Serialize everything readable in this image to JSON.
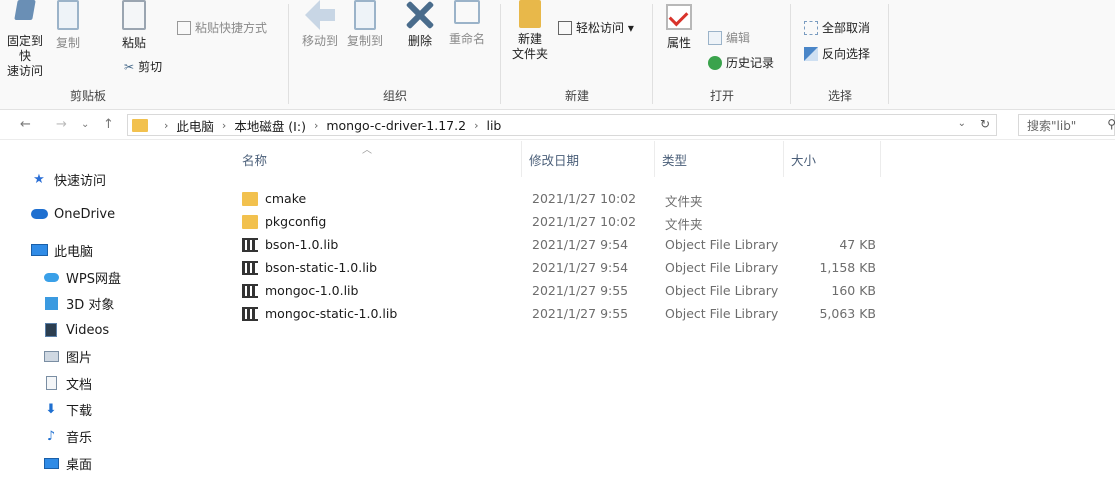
{
  "ribbon": {
    "clipboard": {
      "title": "剪贴板",
      "pin_label": "固定到快\n速访问",
      "copy_label": "复制",
      "paste_label": "粘贴",
      "paste_shortcut_label": "粘贴快捷方式",
      "cut_label": "剪切"
    },
    "organize": {
      "title": "组织",
      "move_label": "移动到",
      "copyto_label": "复制到",
      "delete_label": "删除",
      "rename_label": "重命名"
    },
    "new": {
      "title": "新建",
      "new_folder_label": "新建\n文件夹",
      "easy_access_label": "轻松访问 ▾"
    },
    "open": {
      "title": "打开",
      "properties_label": "属性",
      "edit_label": "编辑",
      "history_label": "历史记录"
    },
    "select": {
      "title": "选择",
      "select_none_label": "全部取消",
      "invert_label": "反向选择"
    }
  },
  "address": {
    "crumbs": [
      "此电脑",
      "本地磁盘 (I:)",
      "mongo-c-driver-1.17.2",
      "lib"
    ],
    "search_placeholder": "搜索\"lib\""
  },
  "nav": {
    "items": [
      {
        "label": "快速访问",
        "icon": "star-icon"
      },
      {
        "label": "OneDrive",
        "icon": "cloud-icon"
      },
      {
        "label": "此电脑",
        "icon": "computer-icon"
      },
      {
        "label": "WPS网盘",
        "icon": "wps-cloud-icon"
      },
      {
        "label": "3D 对象",
        "icon": "cube-icon"
      },
      {
        "label": "Videos",
        "icon": "video-icon"
      },
      {
        "label": "图片",
        "icon": "pictures-icon"
      },
      {
        "label": "文档",
        "icon": "documents-icon"
      },
      {
        "label": "下载",
        "icon": "download-icon"
      },
      {
        "label": "音乐",
        "icon": "music-icon"
      },
      {
        "label": "桌面",
        "icon": "desktop-icon"
      }
    ]
  },
  "files": {
    "columns": {
      "name": "名称",
      "date": "修改日期",
      "type": "类型",
      "size": "大小"
    },
    "rows": [
      {
        "name": "cmake",
        "date": "2021/1/27 10:02",
        "type": "文件夹",
        "size": "",
        "kind": "folder"
      },
      {
        "name": "pkgconfig",
        "date": "2021/1/27 10:02",
        "type": "文件夹",
        "size": "",
        "kind": "folder"
      },
      {
        "name": "bson-1.0.lib",
        "date": "2021/1/27 9:54",
        "type": "Object File Library",
        "size": "47 KB",
        "kind": "lib"
      },
      {
        "name": "bson-static-1.0.lib",
        "date": "2021/1/27 9:54",
        "type": "Object File Library",
        "size": "1,158 KB",
        "kind": "lib"
      },
      {
        "name": "mongoc-1.0.lib",
        "date": "2021/1/27 9:55",
        "type": "Object File Library",
        "size": "160 KB",
        "kind": "lib"
      },
      {
        "name": "mongoc-static-1.0.lib",
        "date": "2021/1/27 9:55",
        "type": "Object File Library",
        "size": "5,063 KB",
        "kind": "lib"
      }
    ]
  },
  "colors": {
    "folder": "#f2c14e",
    "header_text": "#4c607a",
    "quickaccess_star": "#2b6fd6"
  }
}
